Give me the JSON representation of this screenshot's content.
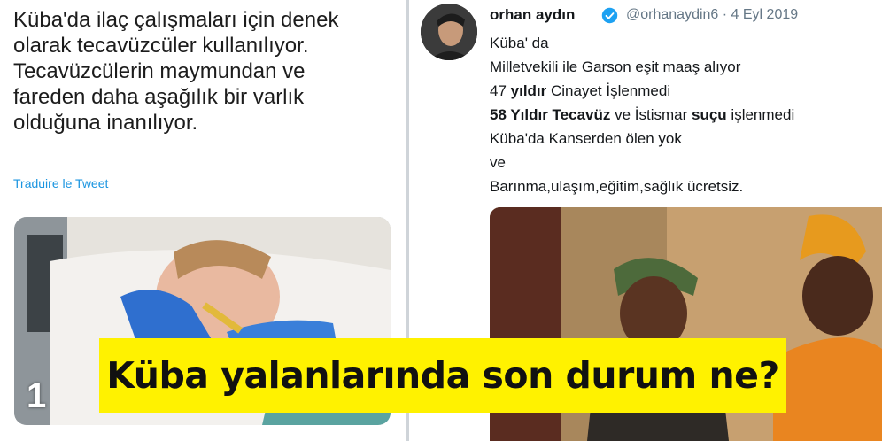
{
  "left_tweet": {
    "text_lines": [
      "Küba'da ilaç çalışmaları için denek",
      "olarak tecavüzcüler kullanılıyor.",
      "Tecavüzcülerin maymundan ve",
      "fareden daha aşağılık bir varlık",
      "olduğuna inanılıyor."
    ],
    "translate_link": "Traduire le Tweet",
    "media_counter": "1"
  },
  "right_tweet": {
    "name": "orhan aydın",
    "handle_date": "@orhanaydin6 · 4 Eyl 2019",
    "line1": "Küba' da",
    "line2": "Milletvekili ile Garson eşit maaş alıyor",
    "line3_num": "47 ",
    "line3_bold": "yıldır",
    "line3_rest": " Cinayet İşlenmedi",
    "line4_bold": "58 Yıldır Tecavüz",
    "line4_mid": " ve İstismar ",
    "line4_bold2": "suçu",
    "line4_rest": " işlenmedi",
    "line5": "Küba'da Kanserden ölen yok",
    "line6": "ve",
    "line7": "Barınma,ulaşım,eğitim,sağlık ücretsiz."
  },
  "headline": "Küba yalanlarında son durum ne?",
  "colors": {
    "link": "#1b95e0",
    "verified": "#1da1f2",
    "headline_bg": "#fff200"
  }
}
